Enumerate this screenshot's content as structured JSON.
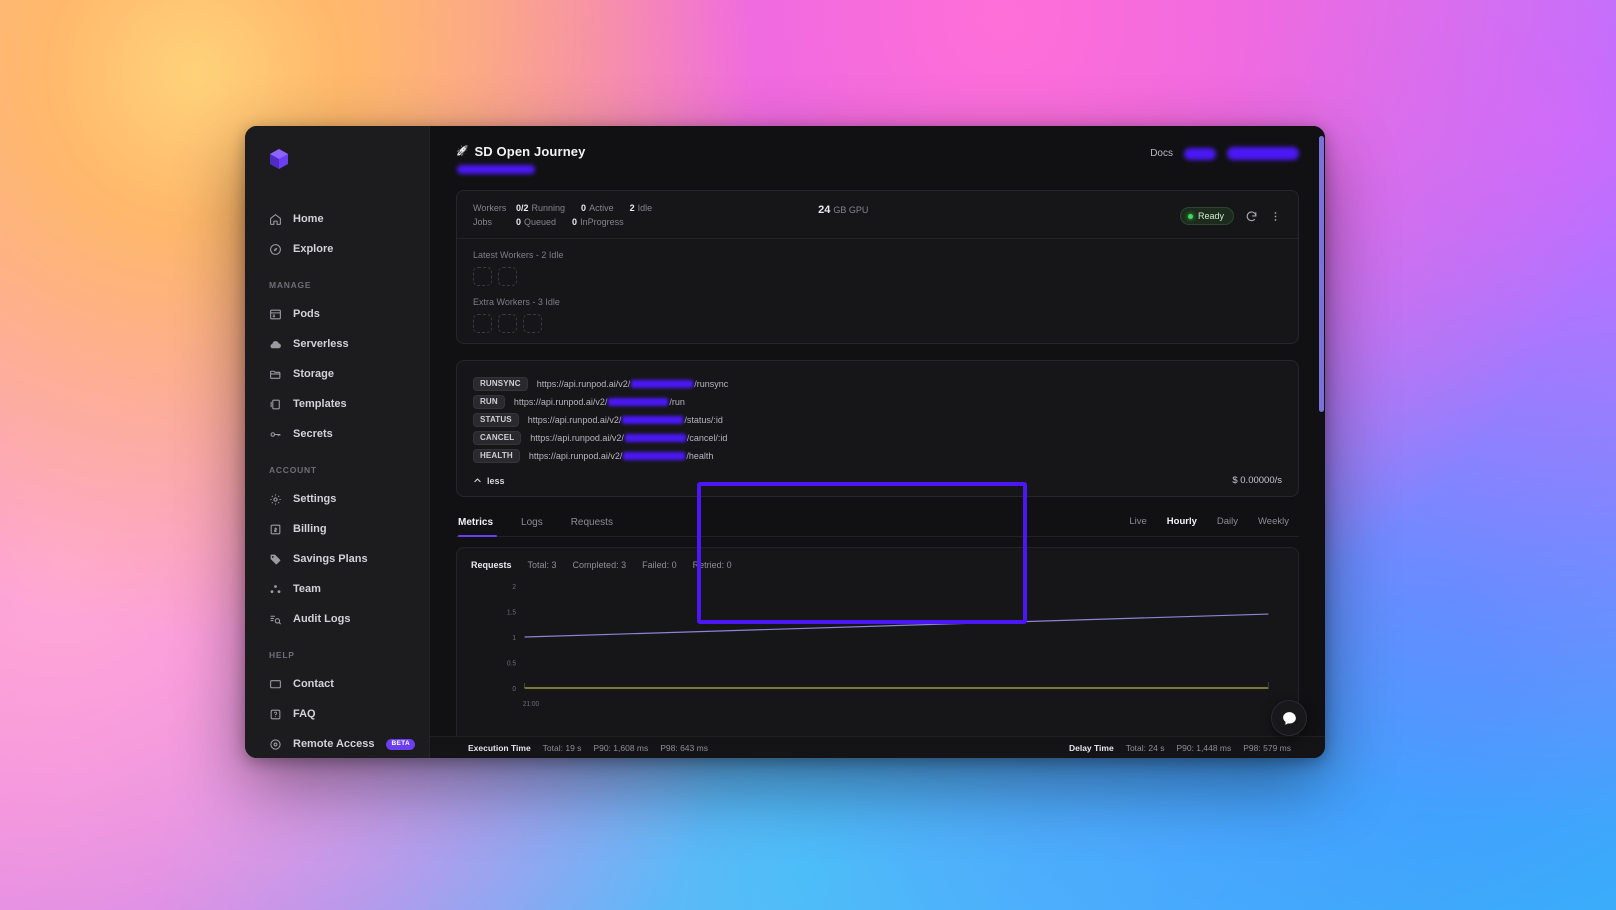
{
  "window": {
    "brand_icon": "cube-logo-icon"
  },
  "sidebar": {
    "groups": [
      {
        "label": "",
        "items": [
          {
            "label": "Home",
            "icon": "home-icon"
          },
          {
            "label": "Explore",
            "icon": "compass-icon"
          }
        ]
      },
      {
        "label": "MANAGE",
        "items": [
          {
            "label": "Pods",
            "icon": "server-icon"
          },
          {
            "label": "Serverless",
            "icon": "cloud-icon"
          },
          {
            "label": "Storage",
            "icon": "folder-icon"
          },
          {
            "label": "Templates",
            "icon": "template-icon"
          },
          {
            "label": "Secrets",
            "icon": "key-icon"
          }
        ]
      },
      {
        "label": "ACCOUNT",
        "items": [
          {
            "label": "Settings",
            "icon": "gear-icon"
          },
          {
            "label": "Billing",
            "icon": "billing-icon"
          },
          {
            "label": "Savings Plans",
            "icon": "tag-icon"
          },
          {
            "label": "Team",
            "icon": "team-icon"
          },
          {
            "label": "Audit Logs",
            "icon": "audit-log-icon"
          }
        ]
      },
      {
        "label": "HELP",
        "items": [
          {
            "label": "Contact",
            "icon": "chat-icon"
          },
          {
            "label": "FAQ",
            "icon": "question-icon"
          },
          {
            "label": "Remote Access",
            "icon": "remote-access-icon",
            "badge": "BETA"
          }
        ]
      }
    ]
  },
  "header": {
    "rocket_glyph": "🚀",
    "title": "SD Open Journey",
    "endpoint_id_redacted": true,
    "docs_label": "Docs",
    "button_1_redacted": true,
    "button_2_redacted": true
  },
  "summary": {
    "workers_key": "Workers",
    "jobs_key": "Jobs",
    "workers": [
      {
        "value": "0/2",
        "label": "Running"
      },
      {
        "value": "0",
        "label": "Active"
      },
      {
        "value": "2",
        "label": "Idle"
      }
    ],
    "jobs": [
      {
        "value": "0",
        "label": "Queued"
      },
      {
        "value": "0",
        "label": "InProgress"
      }
    ],
    "gpu_value": "24",
    "gpu_label": "GB GPU",
    "status": "Ready",
    "refresh_icon": "refresh-icon",
    "menu_icon": "more-vertical-icon",
    "worker_groups": [
      {
        "label": "Latest Workers - 2 Idle",
        "slots": 2
      },
      {
        "label": "Extra Workers - 3 Idle",
        "slots": 3
      }
    ]
  },
  "endpoints": {
    "base_url": "https://api.runpod.ai/v2/",
    "rows": [
      {
        "method": "RUNSYNC",
        "suffix": "/runsync",
        "id_width": 62
      },
      {
        "method": "RUN",
        "suffix": "/run",
        "id_width": 60
      },
      {
        "method": "STATUS",
        "suffix": "/status/:id",
        "id_width": 61
      },
      {
        "method": "CANCEL",
        "suffix": "/cancel/:id",
        "id_width": 61
      },
      {
        "method": "HEALTH",
        "suffix": "/health",
        "id_width": 62
      }
    ],
    "less_label": "less",
    "chevron_icon": "chevron-up-icon",
    "cost": "$ 0.00000/s",
    "highlight_color": "#4b18f5"
  },
  "tabs": {
    "items": [
      {
        "label": "Metrics",
        "active": true
      },
      {
        "label": "Logs",
        "active": false
      },
      {
        "label": "Requests",
        "active": false
      }
    ],
    "ranges": [
      {
        "label": "Live",
        "active": false
      },
      {
        "label": "Hourly",
        "active": true
      },
      {
        "label": "Daily",
        "active": false
      },
      {
        "label": "Weekly",
        "active": false
      }
    ]
  },
  "metrics": {
    "header": {
      "title": "Requests",
      "total": "Total: 3",
      "completed": "Completed: 3",
      "failed": "Failed: 0",
      "retried": "Retried: 0"
    },
    "bottom": {
      "execution": {
        "title": "Execution Time",
        "total": "Total: 19 s",
        "p90": "P90: 1,608 ms",
        "p98": "P98: 643 ms"
      },
      "delay": {
        "title": "Delay Time",
        "total": "Total: 24 s",
        "p90": "P90: 1,448 ms",
        "p98": "P98: 579 ms"
      }
    }
  },
  "chart_data": {
    "type": "line",
    "title": "Requests",
    "xlabel": "",
    "ylabel": "",
    "ylim": [
      0,
      2
    ],
    "yticks": [
      0,
      0.5,
      1,
      1.5,
      2
    ],
    "ytick_labels": [
      "0",
      "0.5",
      "1",
      "1.5",
      "2"
    ],
    "x": [
      0,
      1
    ],
    "xtick_labels": [
      "21:00"
    ],
    "grid": false,
    "legend": "none",
    "series": [
      {
        "name": "completed",
        "color": "#8b85d6",
        "values": [
          1.0,
          1.45
        ]
      },
      {
        "name": "failed",
        "color": "#b7b24a",
        "values": [
          0,
          0
        ]
      }
    ]
  },
  "chat": {
    "icon": "chat-bubble-icon"
  },
  "scrollbar": {
    "thumb_color": "#7b72d8"
  }
}
